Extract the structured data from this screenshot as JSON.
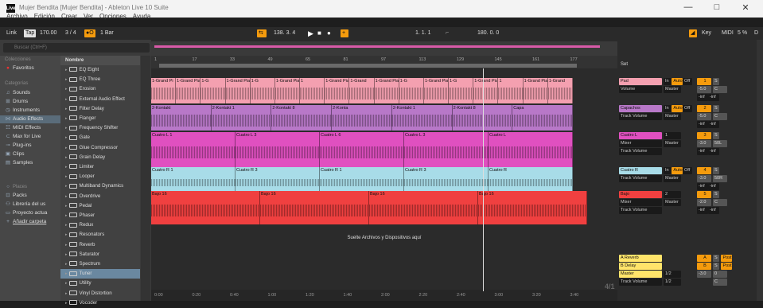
{
  "window": {
    "title": "Mujer Bendita  [Mujer Bendita] - Ableton Live 10 Suite",
    "logo": "Live",
    "minimize": "—",
    "maximize": "□",
    "close": "✕"
  },
  "menu": [
    "Archivo",
    "Edición",
    "Crear",
    "Ver",
    "Opciones",
    "Ayuda"
  ],
  "control_bar": {
    "link": "Link",
    "tap": "Tap",
    "tempo": "170.00",
    "time_sig": "3 / 4",
    "metronome": "●O",
    "quantize": "1 Bar",
    "position": "138.  3.  4",
    "loop_start": "1.  1.  1",
    "loop_length": "180.  0.  0",
    "key": "Key",
    "midi": "MIDI",
    "cpu": "5 %",
    "d": "D"
  },
  "browser": {
    "search_placeholder": "Buscar (Ctrl+F)",
    "collections_header": "Colecciones",
    "favorites": "Favoritos",
    "categories_header": "Categorías",
    "categories": [
      "Sounds",
      "Drums",
      "Instruments",
      "Audio Effects",
      "MIDI Effects",
      "Max for Live",
      "Plug-ins",
      "Clips",
      "Samples"
    ],
    "places_header": "Places",
    "places": [
      "Packs",
      "Librería del us",
      "Proyecto actua",
      "Añadir carpeta"
    ],
    "name_header": "Nombre",
    "items": [
      "EQ Eight",
      "EQ Three",
      "Erosion",
      "External Audio Effect",
      "Filter Delay",
      "Flanger",
      "Frequency Shifter",
      "Gate",
      "Glue Compressor",
      "Grain Delay",
      "Limiter",
      "Looper",
      "Multiband Dynamics",
      "Overdrive",
      "Pedal",
      "Phaser",
      "Redux",
      "Resonators",
      "Reverb",
      "Saturator",
      "Spectrum",
      "Tuner",
      "Utility",
      "Vinyl Distortion",
      "Vocoder"
    ]
  },
  "ruler": [
    "1",
    "17",
    "33",
    "49",
    "65",
    "81",
    "97",
    "113",
    "129",
    "145",
    "161",
    "177"
  ],
  "timeline": [
    "0:00",
    "0:20",
    "0:40",
    "1:00",
    "1:20",
    "1:40",
    "2:00",
    "2:20",
    "2:40",
    "3:00",
    "3:20",
    "3:40"
  ],
  "drop_text": "Suelte Archivos y Dispositivos aquí",
  "set_label": "Set",
  "mixer_fraction": "4/1",
  "tracks": [
    {
      "name": "Pad",
      "color": "#f4a0b0",
      "clips": [
        "1-Grand Pi",
        "1-Grand Piano 4",
        "1-G",
        "1-Grand Piano 4",
        "1-G",
        "1-Grand Piano 10",
        "1",
        "1-Grand Pian",
        "1-Grand",
        "1-Grand Piano 4",
        "1-G",
        "1-Grand Piano 4",
        "1-G",
        "1-Grand Piano 10",
        "1",
        "1-Grand Pian",
        "1-Grand"
      ],
      "input": "Volume",
      "output": "Master",
      "num": "1",
      "vol": "-5.0",
      "pan": "C",
      "inf1": "-inf",
      "inf2": "-inf"
    },
    {
      "name": "Capachos",
      "color": "#b878c8",
      "clips": [
        "2-Kontakt",
        "2-Kontakt 1",
        "2-Kontakt 8",
        "2-Konta",
        "2-Kontakt 1",
        "2-Kontakt 8",
        "Capa"
      ],
      "input": "Track Volume",
      "output": "Master",
      "num": "2",
      "vol": "-5.0",
      "pan": "C",
      "inf1": "-inf",
      "inf2": "-inf"
    },
    {
      "name": "Cuatro L",
      "color": "#e050c0",
      "clips": [
        "Cuatro L 1",
        "Cuatro L 3",
        "Cuatro L 6",
        "Cuatro L 3",
        "Cuatro L"
      ],
      "input": "Mixer",
      "output": "Master",
      "num": "3",
      "vol": "-3.0",
      "pan": "50L",
      "inf1": "-inf",
      "inf2": "-inf",
      "in_left": "1",
      "out_left": "Track Volume"
    },
    {
      "name": "Cuatro R",
      "color": "#a8dce8",
      "clips": [
        "Cuatro R 1",
        "Cuatro R 3",
        "Cuatro R 1",
        "Cuatro R 3",
        "Cuatro R"
      ],
      "input": "Track Volume",
      "output": "Master",
      "num": "4",
      "vol": "-3.0",
      "pan": "50R",
      "inf1": "-inf",
      "inf2": "-inf"
    },
    {
      "name": "Bajo",
      "color": "#f04040",
      "clips": [
        "Bajo 16",
        "Bajo 16",
        "Bajo 16",
        "Bajo 16"
      ],
      "input": "Mixer",
      "output": "Master",
      "num": "5",
      "vol": "-2.0",
      "pan": "C",
      "inf1": "-inf",
      "inf2": "-inf",
      "in_left": "2",
      "out_left": "Track Volume"
    }
  ],
  "returns": [
    {
      "name": "A Reverb",
      "letter": "A",
      "post": "Post"
    },
    {
      "name": "B Delay",
      "letter": "B",
      "post": "Post"
    }
  ],
  "master": {
    "name": "Master",
    "input": "Track Volume",
    "out1": "1/2",
    "out2": "1/2",
    "vol": "-3.0",
    "pan": "0",
    "c": "C"
  },
  "mixer_labels": {
    "in": "In",
    "auto": "Auto",
    "off": "Off",
    "s": "S"
  },
  "colors": {
    "accent": "#f59b0d",
    "pad": "#f4a0b0",
    "capachos": "#b878c8",
    "cuatroL": "#e050c0",
    "cuatroR": "#a8dce8",
    "bajo": "#f04040"
  }
}
